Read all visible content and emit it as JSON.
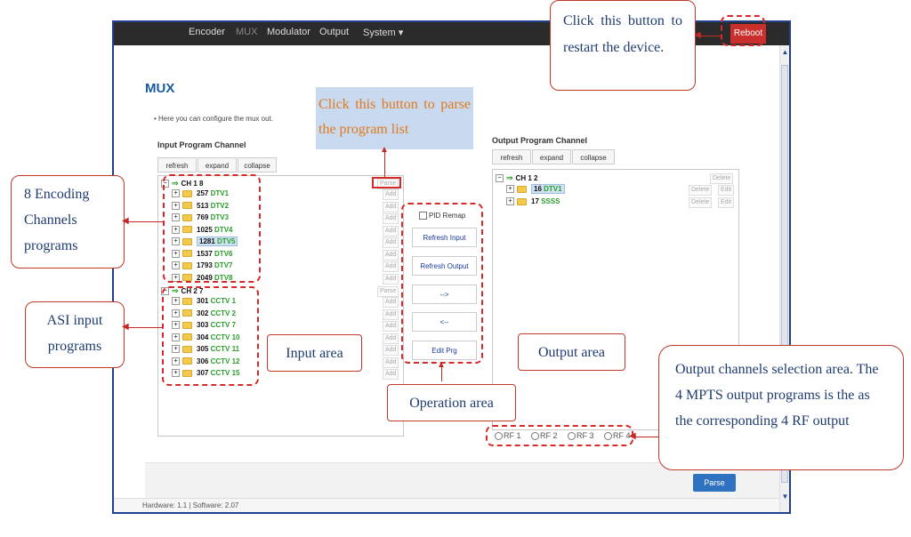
{
  "nav": {
    "items": [
      "Encoder",
      "MUX",
      "Modulator",
      "Output",
      "System ▾"
    ],
    "active_index": 1,
    "reboot_label": "Reboot"
  },
  "page": {
    "title": "MUX",
    "description": "• Here you can configure the mux out."
  },
  "input_panel": {
    "title": "Input Program Channel",
    "buttons": [
      "refresh",
      "expand",
      "collapse"
    ],
    "channels": [
      {
        "label": "CH 1 8",
        "parse_label": "Parse",
        "programs": [
          {
            "num": "257",
            "name": "DTV1"
          },
          {
            "num": "513",
            "name": "DTV2"
          },
          {
            "num": "769",
            "name": "DTV3"
          },
          {
            "num": "1025",
            "name": "DTV4"
          },
          {
            "num": "1281",
            "name": "DTV5"
          },
          {
            "num": "1537",
            "name": "DTV6"
          },
          {
            "num": "1793",
            "name": "DTV7"
          },
          {
            "num": "2049",
            "name": "DTV8"
          }
        ]
      },
      {
        "label": "CH 2 7",
        "parse_label": "Parse",
        "programs": [
          {
            "num": "301",
            "name": "CCTV 1"
          },
          {
            "num": "302",
            "name": "CCTV 2"
          },
          {
            "num": "303",
            "name": "CCTV 7"
          },
          {
            "num": "304",
            "name": "CCTV 10"
          },
          {
            "num": "305",
            "name": "CCTV 11"
          },
          {
            "num": "306",
            "name": "CCTV 12"
          },
          {
            "num": "307",
            "name": "CCTV 15"
          }
        ]
      }
    ],
    "add_label": "Add"
  },
  "operations": {
    "pid_remap_label": "PID Remap",
    "buttons": [
      "Refresh Input",
      "Refresh Output",
      "-->",
      "<--",
      "Edit Prg"
    ]
  },
  "output_panel": {
    "title": "Output Program Channel",
    "buttons": [
      "refresh",
      "expand",
      "collapse"
    ],
    "channel_label": "CH 1 2",
    "delete_label": "Delete",
    "edit_label": "Edit",
    "programs": [
      {
        "num": "16",
        "name": "DTV1"
      },
      {
        "num": "17",
        "name": "SSSS"
      }
    ]
  },
  "rf_options": [
    "RF 1",
    "RF 2",
    "RF 3",
    "RF 4"
  ],
  "footer": {
    "parse_label": "Parse",
    "status": "Hardware: 1.1 | Software: 2.07"
  },
  "annotations": {
    "reboot": "Click this button to restart the device.",
    "parse": "Click this button to parse the program list",
    "encoding": "8 Encoding Channels programs",
    "asi": "ASI input programs",
    "input_area": "Input area",
    "operation_area": "Operation area",
    "output_area": "Output area",
    "output_sel": "Output channels selection area. The 4 MPTS output programs is the as the corresponding 4 RF output"
  },
  "colors": {
    "accent": "#1a5c9e",
    "reboot": "#c9302c",
    "annotation_border": "#c0392b",
    "program_name": "#2a9d2a"
  }
}
